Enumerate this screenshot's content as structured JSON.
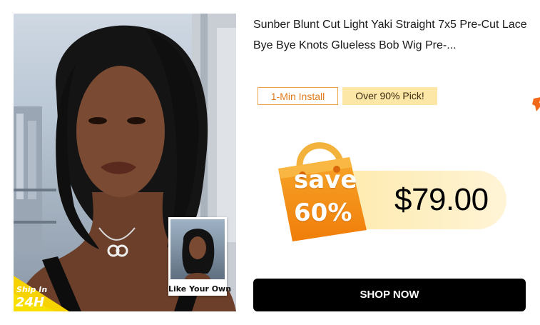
{
  "product": {
    "title": "Sunber Blunt Cut Light Yaki Straight 7x5 Pre-Cut Lace Bye Bye Knots Glueless Bob Wig Pre-...",
    "image_alt": "Model wearing black bob wig"
  },
  "badges": {
    "shipping_line1": "Ship In",
    "shipping_line2": "24H",
    "inset_caption": "Like Your Own"
  },
  "tags": {
    "install": "1-Min Install",
    "pick": "Over 90% Pick!"
  },
  "pricing": {
    "save_word": "save",
    "save_percent": "60%",
    "price": "$79.00"
  },
  "actions": {
    "shop_now": "SHOP NOW"
  },
  "colors": {
    "accent_orange": "#f39a1e",
    "tag_border": "#f0a24a",
    "tag_fill": "#fde7a6",
    "button_bg": "#000000",
    "shipping_badge": "#f5d200"
  },
  "icons": {
    "edge": "partial-orange-icon",
    "bag": "shopping-bag-icon"
  }
}
